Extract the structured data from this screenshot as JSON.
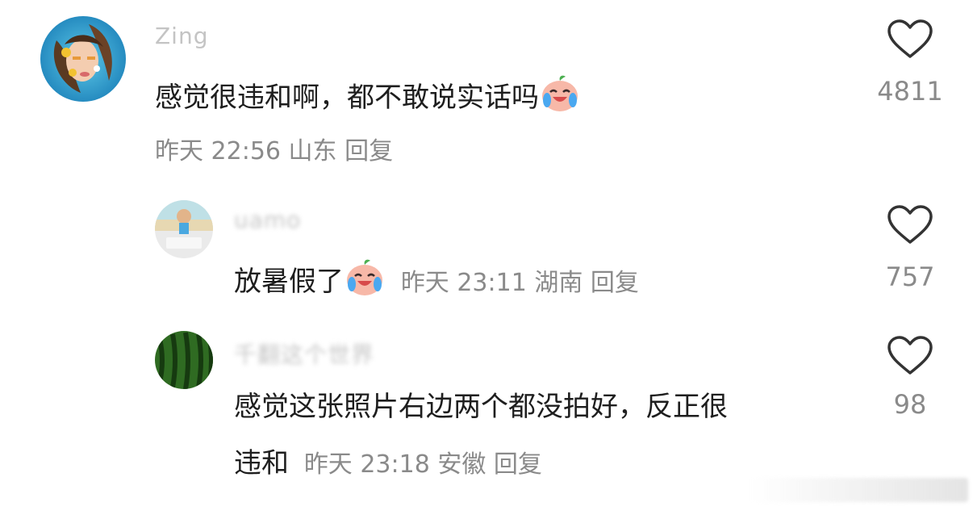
{
  "comments": [
    {
      "username": "Zing",
      "text": "感觉很违和啊，都不敢说实话吗",
      "emoji": "crying-laughing-peach-emoji",
      "time": "昨天 22:56",
      "location": "山东",
      "reply_label": "回复",
      "likes": "4811"
    },
    {
      "username": "uamo",
      "text": "放暑假了",
      "emoji": "crying-laughing-peach-emoji",
      "time": "昨天 23:11",
      "location": "湖南",
      "reply_label": "回复",
      "likes": "757"
    },
    {
      "username": "千翻这个世界",
      "text_line1": "感觉这张照片右边两个都没拍好，反正很",
      "text_line2": "违和",
      "time": "昨天 23:18",
      "location": "安徽",
      "reply_label": "回复",
      "likes": "98"
    }
  ],
  "icons": {
    "like": "heart-outline-icon"
  },
  "colors": {
    "text": "#1e1e1e",
    "meta": "#8a8a8a",
    "username": "#c4c4c4",
    "background": "#ffffff"
  }
}
